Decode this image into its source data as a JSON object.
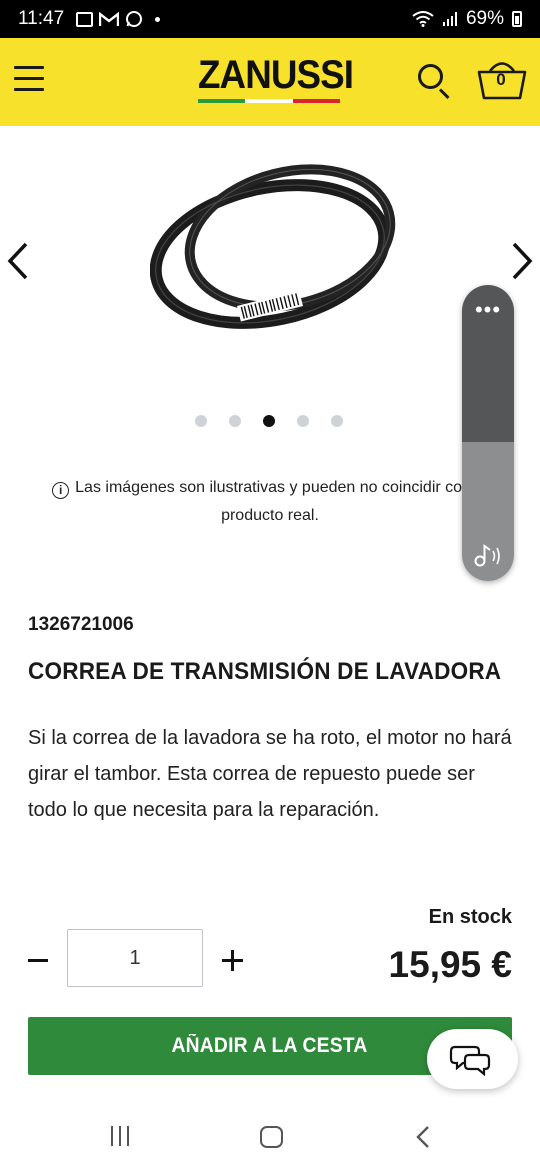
{
  "status_bar": {
    "time": "11:47",
    "notification_icons": [
      "gallery-icon",
      "gmail-icon",
      "whatsapp-icon"
    ],
    "battery": "69%"
  },
  "header": {
    "logo_text": "ZANUSSI",
    "cart_count": "0",
    "background_color": "#f7e12a"
  },
  "carousel": {
    "image_alt": "drive-belt-product",
    "slide_count": 5,
    "active_slide": 3
  },
  "disclaimer": {
    "text": "Las imágenes son ilustrativas y pueden no coincidir con el producto real."
  },
  "product": {
    "sku": "1326721006",
    "title": "CORREA DE TRANSMISIÓN DE LAVADORA",
    "description": "Si la correa de la lavadora se ha roto, el motor no hará girar el tambor. Esta correa de repuesto puede ser todo lo que necesita para la reparación.",
    "stock": "En stock",
    "price": "15,95 €",
    "quantity": "1"
  },
  "actions": {
    "add_to_cart": "AÑADIR A LA CESTA",
    "accent_color": "#2f8b3b"
  }
}
